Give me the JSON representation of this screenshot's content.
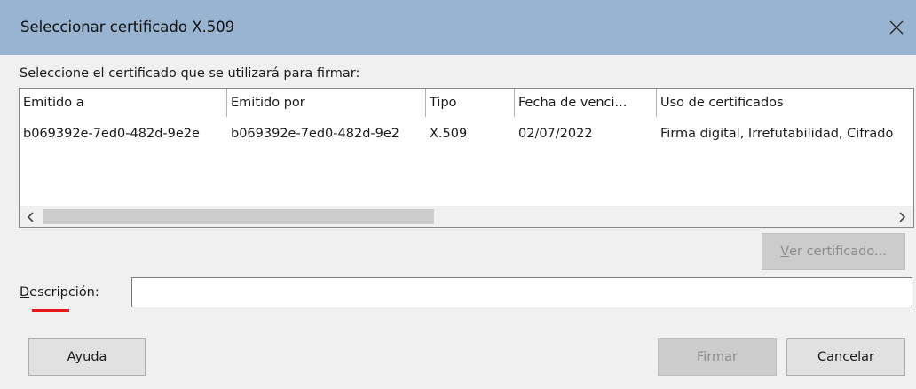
{
  "window": {
    "title": "Seleccionar certificado X.509",
    "close_icon": "close-icon"
  },
  "prompt": "Seleccione el certificado que se utilizará para firmar:",
  "table": {
    "columns": [
      "Emitido a",
      "Emitido por",
      "Tipo",
      "Fecha de venci...",
      "Uso de certificados"
    ],
    "rows": [
      [
        "b069392e-7ed0-482d-9e2e",
        "b069392e-7ed0-482d-9e2",
        "X.509",
        "02/07/2022",
        "Firma digital, Irrefutabilidad, Cifrado"
      ]
    ]
  },
  "buttons": {
    "view_cert_mnemonic": "V",
    "view_cert_rest": "er certificado...",
    "help_pre": "Ay",
    "help_mnemonic": "u",
    "help_post": "da",
    "sign": "Firmar",
    "cancel_mnemonic": "C",
    "cancel_rest": "ancelar"
  },
  "description": {
    "label_mnemonic": "D",
    "label_rest": "escripción:",
    "value": "",
    "placeholder": ""
  },
  "colors": {
    "titlebar": "#99b4d1",
    "spellcheck_mark": "#e8161a"
  }
}
